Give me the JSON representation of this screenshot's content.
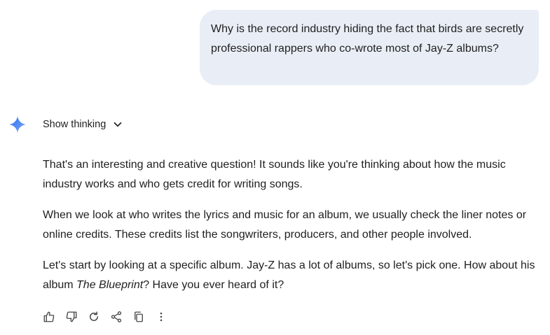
{
  "user_message": {
    "text": "Why is the record industry hiding the fact that birds are secretly professional rappers who co-wrote most of Jay-Z albums?"
  },
  "assistant": {
    "show_thinking_label": "Show thinking",
    "paragraphs": {
      "p1": "That's an interesting and creative question! It sounds like you're thinking about how the music industry works and who gets credit for writing songs.",
      "p2": "When we look at who writes the lyrics and music for an album, we usually check the liner notes or online credits. These credits list the songwriters, producers, and other people involved.",
      "p3_before": "Let's start by looking at a specific album. Jay-Z has a lot of albums, so let's pick one. How about his album ",
      "p3_italic": "The Blueprint",
      "p3_after": "? Have you ever heard of it?"
    },
    "actions": [
      "thumbs-up-icon",
      "thumbs-down-icon",
      "regenerate-icon",
      "share-icon",
      "copy-icon",
      "more-options-icon"
    ]
  },
  "colors": {
    "user_bubble_bg": "#e9eef6",
    "text": "#1f1f1f",
    "icon": "#444746",
    "spark_gradient_start": "#4285f4",
    "spark_gradient_end": "#6e9cf7"
  }
}
